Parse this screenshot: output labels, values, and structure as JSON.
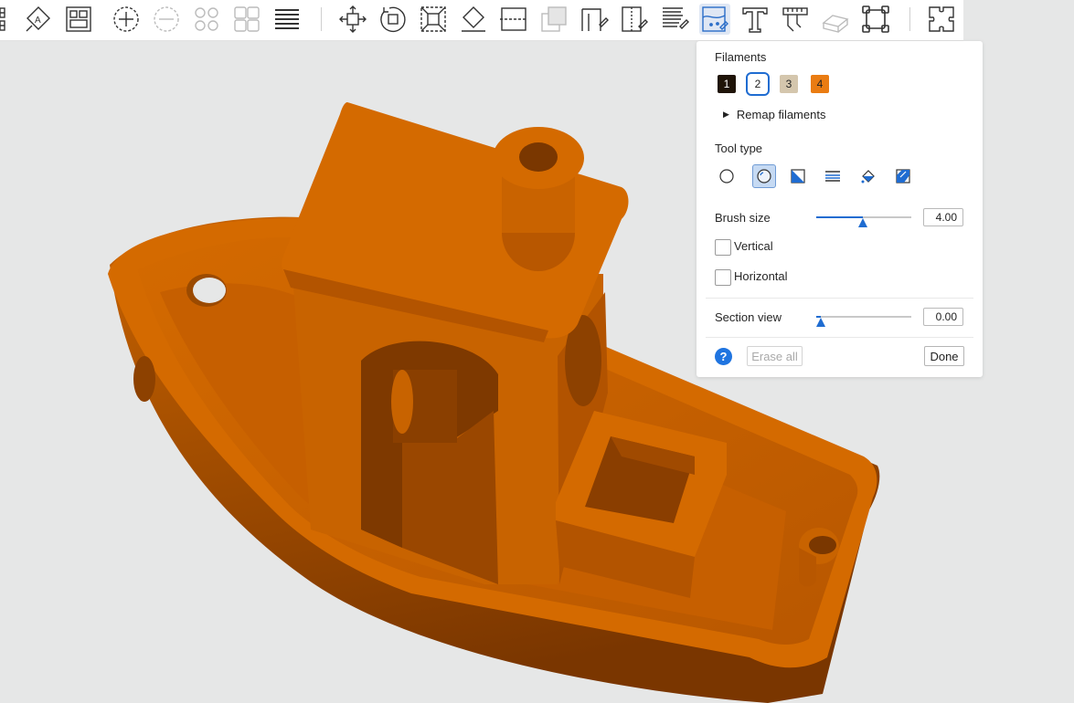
{
  "toolbar": {
    "icons": [
      "arrange-grid-icon",
      "auto-orient-icon",
      "plate-layout-icon",
      "add-instance-icon",
      "remove-instance-icon",
      "split-objects-icon",
      "split-parts-icon",
      "layers-icon",
      "move-icon",
      "rotate-icon",
      "scale-icon",
      "lay-on-face-icon",
      "cut-icon",
      "boolean-icon",
      "support-paint-icon",
      "seam-paint-icon",
      "fuzzy-skin-icon",
      "color-paint-icon",
      "text-icon",
      "measure-icon",
      "assembly-icon",
      "variable-layer-icon",
      "puzzle-icon"
    ],
    "active_tool": "color-paint-icon"
  },
  "panel": {
    "filaments_label": "Filaments",
    "filaments": [
      {
        "label": "1",
        "color": "#1f1408",
        "text_color": "#ffffff"
      },
      {
        "label": "2",
        "color": "#ffffff",
        "text_color": "#222222"
      },
      {
        "label": "3",
        "color": "#d4c6ad",
        "text_color": "#222222"
      },
      {
        "label": "4",
        "color": "#ea7c12",
        "text_color": "#222222"
      }
    ],
    "selected_filament": "2",
    "remap_label": "Remap filaments",
    "tool_type_label": "Tool type",
    "tool_types": [
      "circle-brush-icon",
      "sphere-brush-icon",
      "triangle-icon",
      "height-range-icon",
      "fill-bucket-icon",
      "gap-fill-icon"
    ],
    "active_tool_type": "sphere-brush-icon",
    "brush_size_label": "Brush size",
    "brush_size_value": "4.00",
    "brush_size_fraction": 0.49,
    "vertical_label": "Vertical",
    "horizontal_label": "Horizontal",
    "section_view_label": "Section view",
    "section_view_value": "0.00",
    "section_view_fraction": 0.05,
    "help_label": "?",
    "erase_all_label": "Erase all",
    "done_label": "Done"
  },
  "colors": {
    "accent": "#1f6cd1",
    "model_orange": "#d96d00",
    "background": "#e6e7e7"
  }
}
